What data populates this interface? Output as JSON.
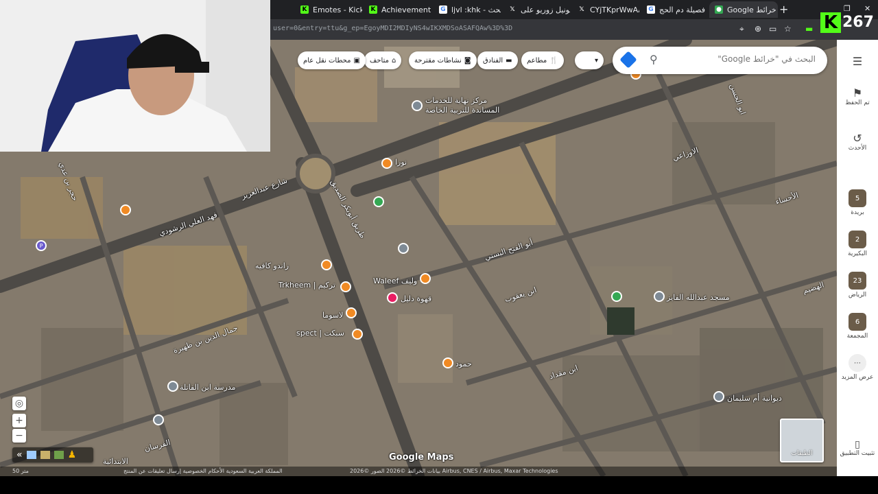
{
  "browser": {
    "tabs": [
      {
        "title": "Emotes - Kick",
        "favicon": "kick-icon",
        "color": "#53fc18"
      },
      {
        "title": "Achievements",
        "favicon": "kick-icon",
        "color": "#53fc18"
      },
      {
        "title": "ljvl :khk - بحث",
        "favicon": "google-icon",
        "color": "#ffffff"
      },
      {
        "title": "ليونيل زوريو على",
        "favicon": "x-icon",
        "color": "#000000"
      },
      {
        "title": "CYjTKprWwAA",
        "favicon": "x-icon",
        "color": "#000000"
      },
      {
        "title": "فصيلة دم الحج",
        "favicon": "google-icon",
        "color": "#ffffff"
      },
      {
        "title": "Google خرائط",
        "favicon": "maps-icon",
        "color": "#34a853"
      }
    ],
    "url": "user=0&entry=ttu&g_ep=EgoyMDI2MDIyNS4wIKXMDSoASAFQAw%3D%3D"
  },
  "stream": {
    "viewer_count": "267",
    "logo_letter": "K"
  },
  "search": {
    "placeholder": "البحث في \"خرائط Google\""
  },
  "categories": [
    {
      "label": "مطاعم",
      "icon": "restaurant-icon"
    },
    {
      "label": "الفنادق",
      "icon": "hotel-icon"
    },
    {
      "label": "نشاطات مقترحة",
      "icon": "camera-icon"
    },
    {
      "label": "متاحف",
      "icon": "museum-icon"
    },
    {
      "label": "محطات نقل عام",
      "icon": "transit-icon"
    }
  ],
  "rail": {
    "saved": "تم الحفظ",
    "recent": "الأحدث",
    "places": [
      {
        "label": "بريدة",
        "badge": "5"
      },
      {
        "label": "البكيرية",
        "badge": "2"
      },
      {
        "label": "الرياض",
        "badge": "23"
      },
      {
        "label": "المجمعة",
        "badge": "6"
      }
    ],
    "more": "عرض المزيد",
    "install": "تثبيت التطبيق"
  },
  "map": {
    "labels": [
      "مركز نهاية للخدمات",
      "المساندة للتربية الخاصة",
      "نورا",
      "شارع عبدالعزيز",
      "فهد العلي الرشودي",
      "طريق أبوبكر الصديق",
      "راندو كافيه",
      "Trkheem | تركيم",
      "Waleef وليف",
      "قهوة دليل",
      "لاسوما",
      "spect | سبكت",
      "أبو الفتح البستي",
      "ابن يعقوب",
      "مسجد عبدالله الفايز",
      "ابن مقداد",
      "ديوانية أم سليمان",
      "حجر بن عدي",
      "جمال الدين بن ظهيرة",
      "مدرسة ابن الفاتلة",
      "الفرسان",
      "الابتدائية",
      "حمود",
      "ابو الحسن",
      "الاوزاعي",
      "الأحساء",
      "الهضيم"
    ],
    "layers_label": "الطبقات",
    "scale": "50 متر",
    "attribution": "بيانات الخرائط ©2026 الصور ©2026 Airbus, CNES / Airbus, Maxar Technologies",
    "footer": "المملكة العربية السعودية   الأحكام   الخصوصية   إرسال تعليقات عن المنتج",
    "google_logo": "Google Maps"
  }
}
